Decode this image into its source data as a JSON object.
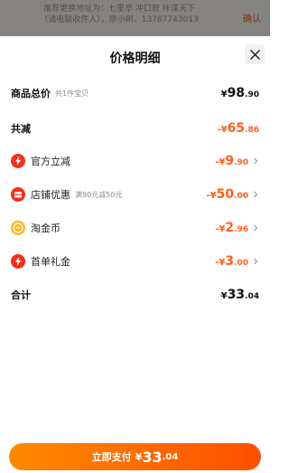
{
  "background": {
    "banner_line1": "推荐更换地址为：七里亭 冲口窟 咔谋天下",
    "banner_line2": "（请电联收件人），廖小树，13787743013",
    "confirm": "确认"
  },
  "sheet": {
    "title": "价格明细",
    "close_icon": "close-icon"
  },
  "rows": {
    "total": {
      "label": "商品总价",
      "sub": "共1件宝贝",
      "currency": "¥",
      "int": "98",
      "dec": ".90"
    },
    "reduction": {
      "label": "共减",
      "currency": "-¥",
      "int": "65",
      "dec": ".86"
    },
    "official": {
      "label": "官方立减",
      "currency": "-¥",
      "int": "9",
      "dec": ".90",
      "icon": "lightning-icon"
    },
    "shop": {
      "label": "店铺优惠",
      "sub": "满90元减50元",
      "currency": "-¥",
      "int": "50",
      "dec": ".00",
      "icon": "shop-icon"
    },
    "coin": {
      "label": "淘金币",
      "currency": "-¥",
      "int": "2",
      "dec": ".96",
      "icon": "coin-icon"
    },
    "first": {
      "label": "首单礼金",
      "currency": "-¥",
      "int": "3",
      "dec": ".00",
      "icon": "lightning-icon"
    },
    "sum": {
      "label": "合计",
      "currency": "¥",
      "int": "33",
      "dec": ".04"
    }
  },
  "pay_button": {
    "label": "立即支付",
    "currency": "¥",
    "int": "33",
    "dec": ".04"
  },
  "colors": {
    "accent": "#ff5f1f",
    "red_icon": "#f2301b",
    "coin": "#ffb51c"
  }
}
